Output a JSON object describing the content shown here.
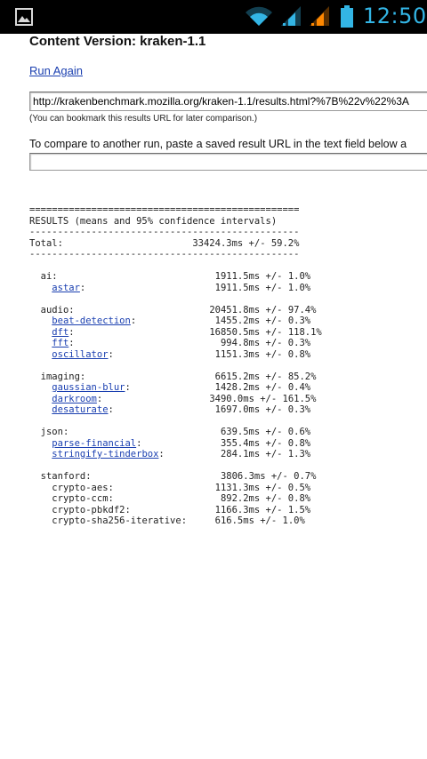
{
  "status_bar": {
    "time": "12:50",
    "icons": [
      "gallery-icon",
      "wifi-icon",
      "signal-icon",
      "signal-icon",
      "battery-icon"
    ],
    "accent_color": "#33b5e5"
  },
  "page": {
    "content_version": "Content Version: kraken-1.1",
    "run_again": "Run Again",
    "results_url": "http://krakenbenchmark.mozilla.org/kraken-1.1/results.html?%7B%22v%22%3A",
    "bookmark_note": "(You can bookmark this results URL for later comparison.)",
    "compare_text": "To compare to another run, paste a saved result URL in the text field below a",
    "compare_placeholder": ""
  },
  "results": {
    "rule": "================================================",
    "header": "RESULTS (means and 95% confidence intervals)",
    "divider": "------------------------------------------------",
    "total_label": "Total:",
    "total_value": "33424.3ms +/- 59.2%",
    "groups": [
      {
        "name": "ai:",
        "value": "1911.5ms +/- 1.0%",
        "tests": [
          {
            "name": "astar",
            "link": true,
            "value": "1911.5ms +/- 1.0%"
          }
        ]
      },
      {
        "name": "audio:",
        "value": "20451.8ms +/- 97.4%",
        "tests": [
          {
            "name": "beat-detection",
            "link": true,
            "value": "1455.2ms +/- 0.3%"
          },
          {
            "name": "dft",
            "link": true,
            "value": "16850.5ms +/- 118.1%"
          },
          {
            "name": "fft",
            "link": true,
            "value": "994.8ms +/- 0.3%"
          },
          {
            "name": "oscillator",
            "link": true,
            "value": "1151.3ms +/- 0.8%"
          }
        ]
      },
      {
        "name": "imaging:",
        "value": "6615.2ms +/- 85.2%",
        "tests": [
          {
            "name": "gaussian-blur",
            "link": true,
            "value": "1428.2ms +/- 0.4%"
          },
          {
            "name": "darkroom",
            "link": true,
            "value": "3490.0ms +/- 161.5%"
          },
          {
            "name": "desaturate",
            "link": true,
            "value": "1697.0ms +/- 0.3%"
          }
        ]
      },
      {
        "name": "json:",
        "value": "639.5ms +/- 0.6%",
        "tests": [
          {
            "name": "parse-financial",
            "link": true,
            "value": "355.4ms +/- 0.8%"
          },
          {
            "name": "stringify-tinderbox",
            "link": true,
            "value": "284.1ms +/- 1.3%"
          }
        ]
      },
      {
        "name": "stanford:",
        "value": "3806.3ms +/- 0.7%",
        "tests": [
          {
            "name": "crypto-aes",
            "link": false,
            "value": "1131.3ms +/- 0.5%"
          },
          {
            "name": "crypto-ccm",
            "link": false,
            "value": "892.2ms +/- 0.8%"
          },
          {
            "name": "crypto-pbkdf2",
            "link": false,
            "value": "1166.3ms +/- 1.5%"
          },
          {
            "name": "crypto-sha256-iterative",
            "link": false,
            "value": "616.5ms +/- 1.0%"
          }
        ]
      }
    ]
  }
}
